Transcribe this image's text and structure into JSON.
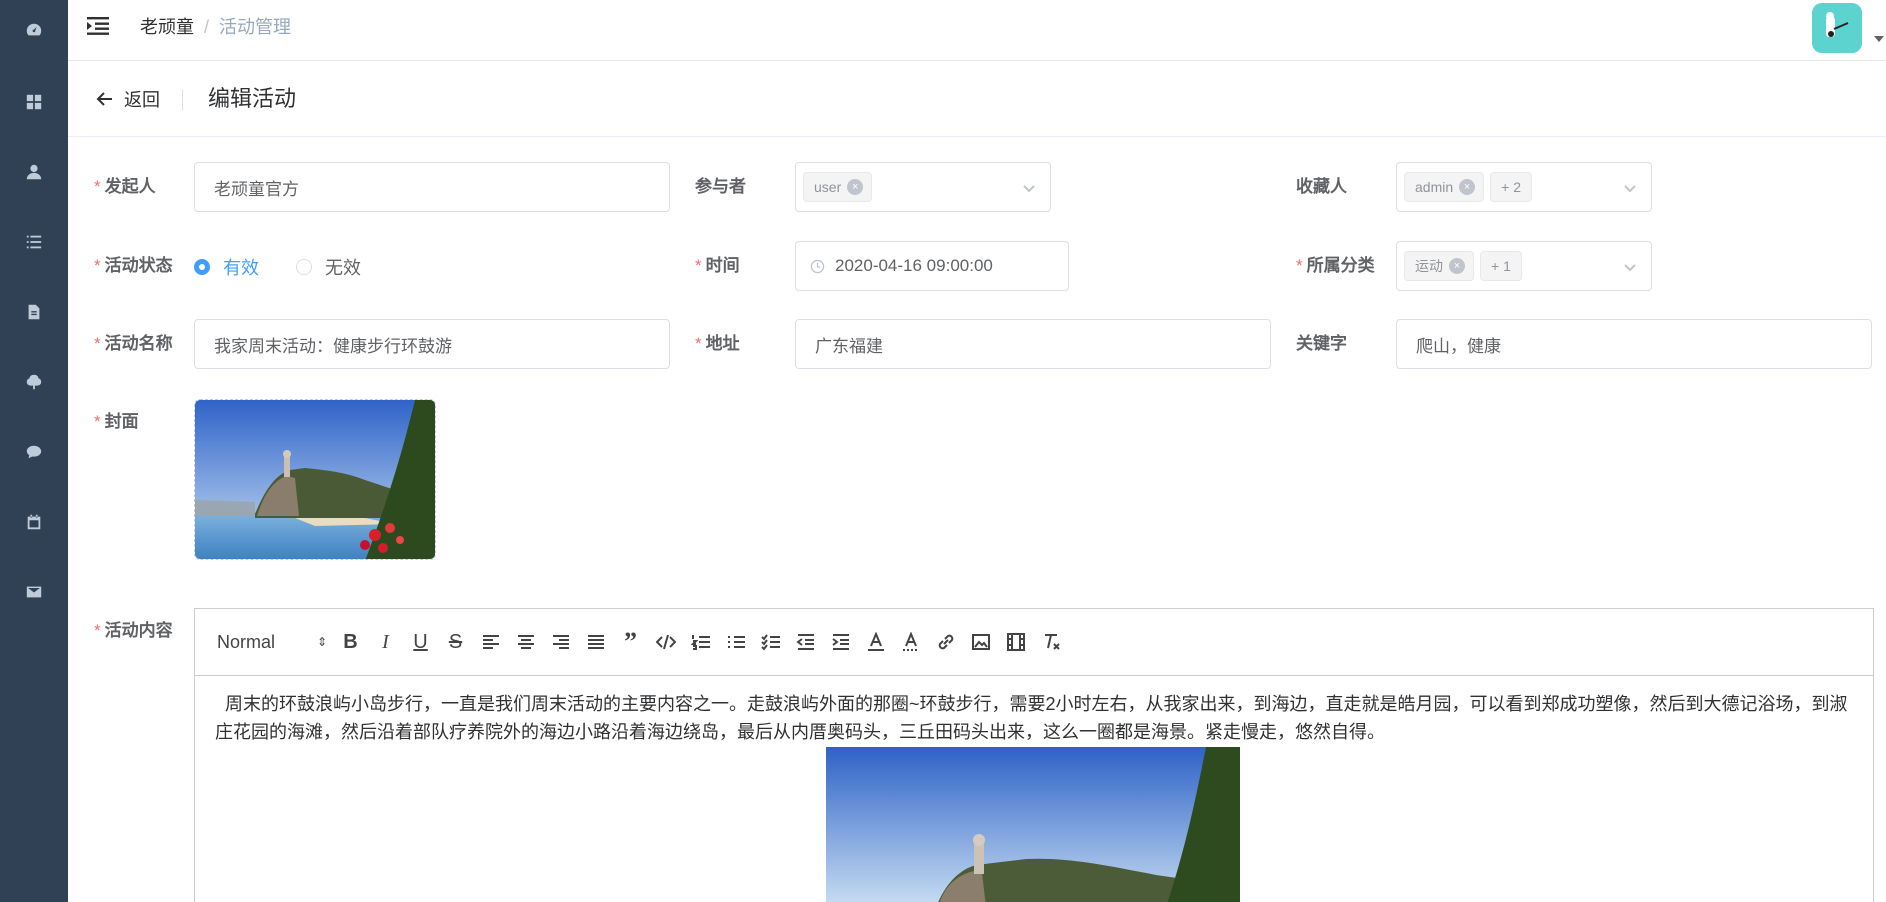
{
  "sidebar": {
    "icons": [
      "dashboard-icon",
      "grid-icon",
      "user-icon",
      "list-icon",
      "document-icon",
      "tree-icon",
      "chat-icon",
      "calendar-icon",
      "mail-icon"
    ]
  },
  "navbar": {
    "breadcrumb_root": "老顽童",
    "breadcrumb_sep": "/",
    "breadcrumb_current": "活动管理"
  },
  "page_header": {
    "back_label": "返回",
    "title": "编辑活动"
  },
  "form": {
    "initiator": {
      "label": "发起人",
      "value": "老顽童官方"
    },
    "participants": {
      "label": "参与者",
      "tags": [
        "user"
      ]
    },
    "collectors": {
      "label": "收藏人",
      "tags": [
        "admin"
      ],
      "more": "+ 2"
    },
    "status": {
      "label": "活动状态",
      "options": [
        "有效",
        "无效"
      ],
      "selected": "有效"
    },
    "time": {
      "label": "时间",
      "value": "2020-04-16 09:00:00"
    },
    "category": {
      "label": "所属分类",
      "tags": [
        "运动"
      ],
      "more": "+ 1"
    },
    "name": {
      "label": "活动名称",
      "value": "我家周末活动：健康步行环鼓游"
    },
    "address": {
      "label": "地址",
      "value": "广东福建"
    },
    "keywords": {
      "label": "关键字",
      "value": "爬山，健康"
    },
    "cover": {
      "label": "封面"
    },
    "content": {
      "label": "活动内容",
      "format": "Normal",
      "text": "周末的环鼓浪屿小岛步行，一直是我们周末活动的主要内容之一。走鼓浪屿外面的那圈~环鼓步行，需要2小时左右，从我家出来，到海边，直走就是皓月园，可以看到郑成功塑像，然后到大德记浴场，到淑庄花园的海滩，然后沿着部队疗养院外的海边小路沿着海边绕岛，最后从内厝奥码头，三丘田码头出来，这么一圈都是海景。紧走慢走，悠然自得。"
    }
  },
  "colors": {
    "sidebar_bg": "#304156",
    "primary": "#409eff",
    "required": "#f56c6c",
    "avatar_bg": "#5dd3d0"
  }
}
